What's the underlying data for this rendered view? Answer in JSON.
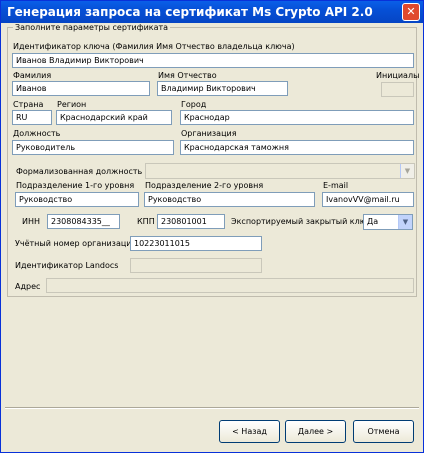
{
  "window": {
    "title": "Генерация запроса на сертификат Ms Crypto API 2.0",
    "close_glyph": "✕"
  },
  "group": {
    "label": "Заполните параметры сертификата"
  },
  "fields": {
    "key_id": {
      "label": "Идентификатор ключа (Фамилия Имя Отчество владельца ключа)",
      "value": "Иванов Владимир Викторович"
    },
    "surname": {
      "label": "Фамилия",
      "value": "Иванов"
    },
    "name_patronymic": {
      "label": "Имя Отчество",
      "value": "Владимир Викторович"
    },
    "initials": {
      "label": "Инициалы",
      "value": ""
    },
    "country": {
      "label": "Страна",
      "value": "RU"
    },
    "region": {
      "label": "Регион",
      "value": "Краснодарский край"
    },
    "city": {
      "label": "Город",
      "value": "Краснодар"
    },
    "position": {
      "label": "Должность",
      "value": "Руководитель"
    },
    "organization": {
      "label": "Организация",
      "value": "Краснодарская таможня"
    },
    "formal_position": {
      "label": "Формализованная должность",
      "value": ""
    },
    "division1": {
      "label": "Подразделение 1-го уровня",
      "value": "Руководство"
    },
    "division2": {
      "label": "Подразделение 2-го уровня",
      "value": "Руководство"
    },
    "email": {
      "label": "E-mail",
      "value": "IvanovVV@mail.ru"
    },
    "inn": {
      "label": "ИНН",
      "value": "2308084335__"
    },
    "kpp": {
      "label": "КПП",
      "value": "230801001"
    },
    "exportable_key": {
      "label": "Экспортируемый закрытый ключ",
      "value": "Да"
    },
    "org_number": {
      "label": "Учётный номер организации",
      "value": "10223011015"
    },
    "landocs_id": {
      "label": "Идентификатор Landocs",
      "value": ""
    },
    "address": {
      "label": "Адрес",
      "value": ""
    }
  },
  "buttons": {
    "back": "< Назад",
    "next": "Далее >",
    "cancel": "Отмена"
  }
}
